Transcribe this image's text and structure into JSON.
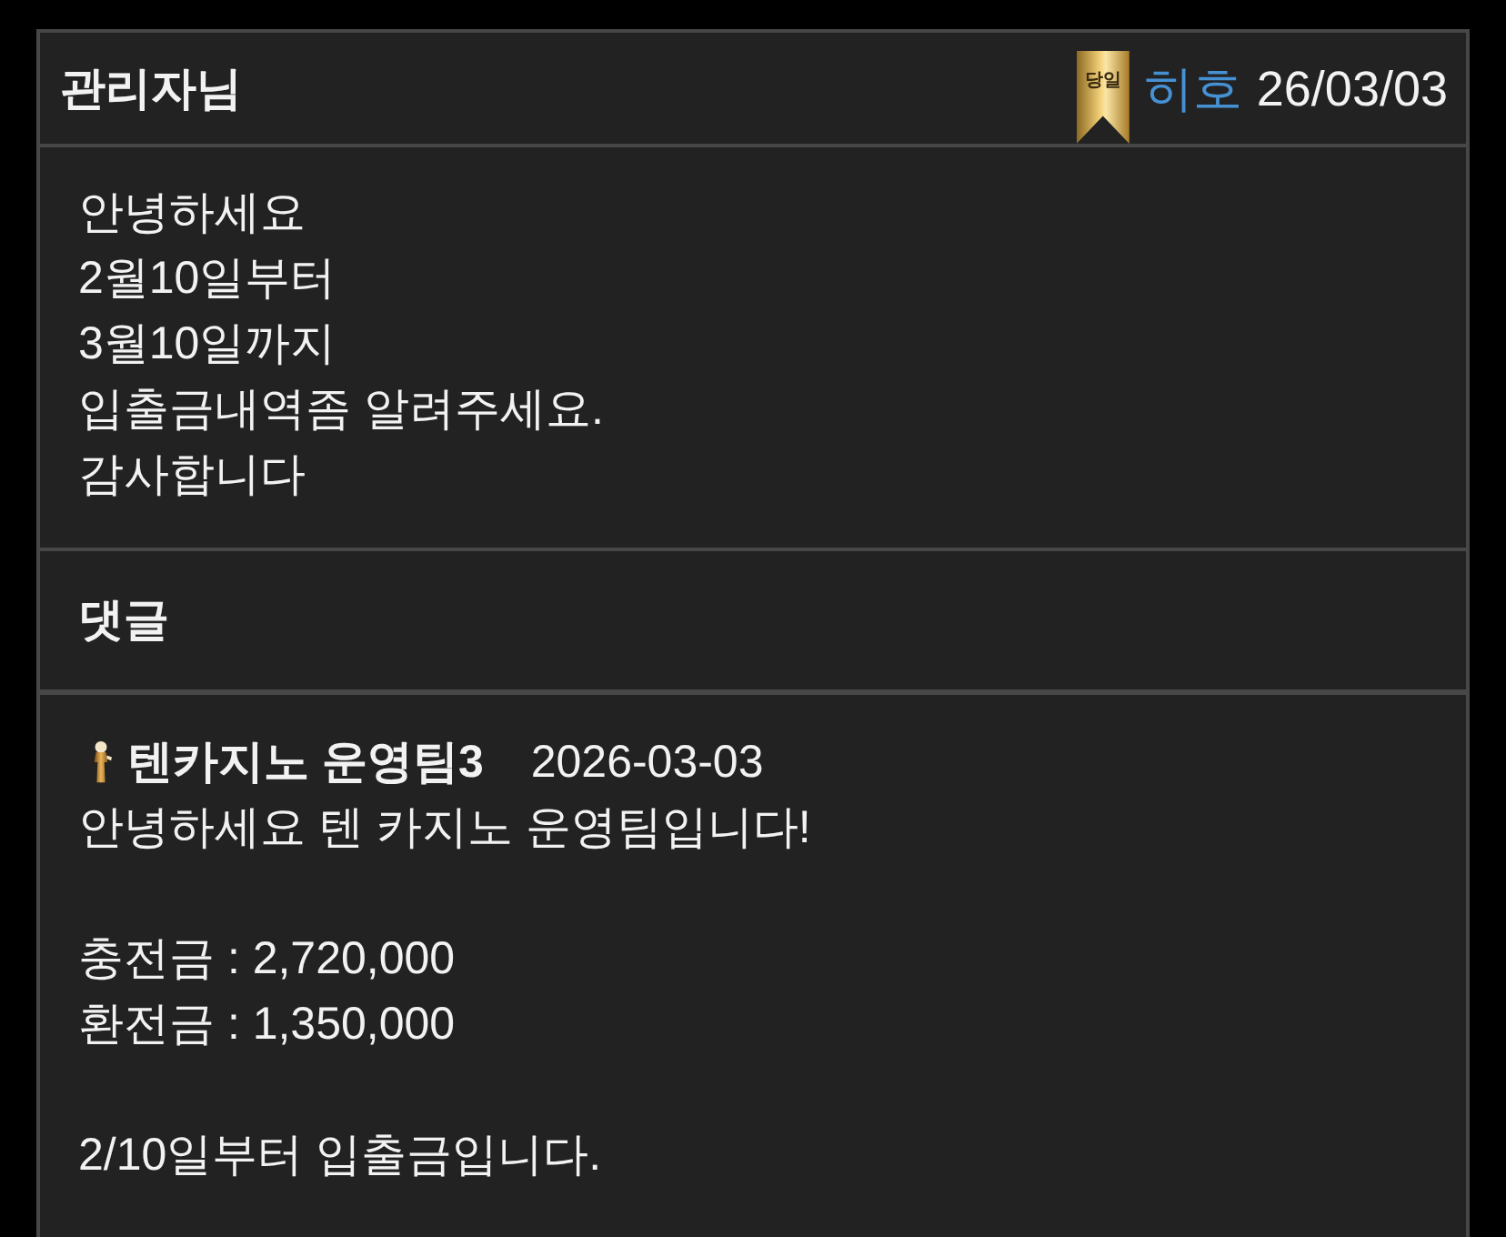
{
  "post": {
    "title": "관리자님",
    "badge": "당일",
    "author": "히호",
    "date": "26/03/03",
    "body_lines": [
      "안녕하세요",
      "2월10일부터",
      "3월10일까지",
      "입출금내역좀 알려주세요.",
      "감사합니다"
    ]
  },
  "comments_heading": "댓글",
  "comments": [
    {
      "author": "텐카지노 운영팀3",
      "date": "2026-03-03",
      "paragraphs": [
        [
          "안녕하세요 텐 카지노 운영팀입니다!"
        ],
        [
          "충전금 : 2,720,000",
          "환전금 : 1,350,000"
        ],
        [
          "2/10일부터 입출금입니다."
        ]
      ]
    }
  ]
}
